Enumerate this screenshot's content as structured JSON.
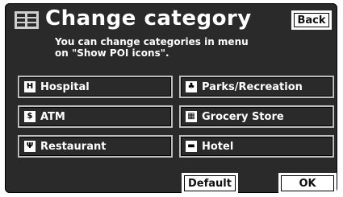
{
  "header": {
    "title": "Change category",
    "back_label": "Back"
  },
  "note": "You can change categories in menu\non \"Show POI icons\".",
  "categories": [
    {
      "label": "Hospital",
      "icon": "hospital-icon",
      "glyph": "H"
    },
    {
      "label": "Parks/Recreation",
      "icon": "park-icon",
      "glyph": "♣"
    },
    {
      "label": "ATM",
      "icon": "atm-icon",
      "glyph": "$"
    },
    {
      "label": "Grocery Store",
      "icon": "grocery-icon",
      "glyph": "▦"
    },
    {
      "label": "Restaurant",
      "icon": "restaurant-icon",
      "glyph": "Ψ"
    },
    {
      "label": "Hotel",
      "icon": "hotel-icon",
      "glyph": "▬"
    }
  ],
  "footer": {
    "default_label": "Default",
    "ok_label": "OK"
  }
}
